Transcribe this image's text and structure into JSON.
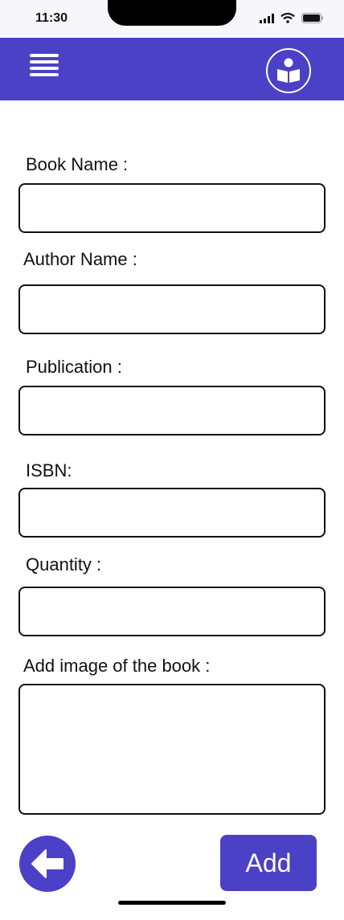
{
  "status_bar": {
    "time": "11:30"
  },
  "app_bar": {
    "menu_icon": "hamburger-menu-icon",
    "logo_icon": "reading-book-icon"
  },
  "form": {
    "fields": [
      {
        "label": "Book Name :",
        "value": ""
      },
      {
        "label": "Author Name :",
        "value": ""
      },
      {
        "label": "Publication :",
        "value": ""
      },
      {
        "label": "ISBN:",
        "value": ""
      },
      {
        "label": "Quantity :",
        "value": ""
      }
    ],
    "image_label": "Add image of the book :"
  },
  "actions": {
    "back_icon": "arrow-left-icon",
    "add_label": "Add"
  },
  "colors": {
    "accent": "#4b41c6"
  }
}
